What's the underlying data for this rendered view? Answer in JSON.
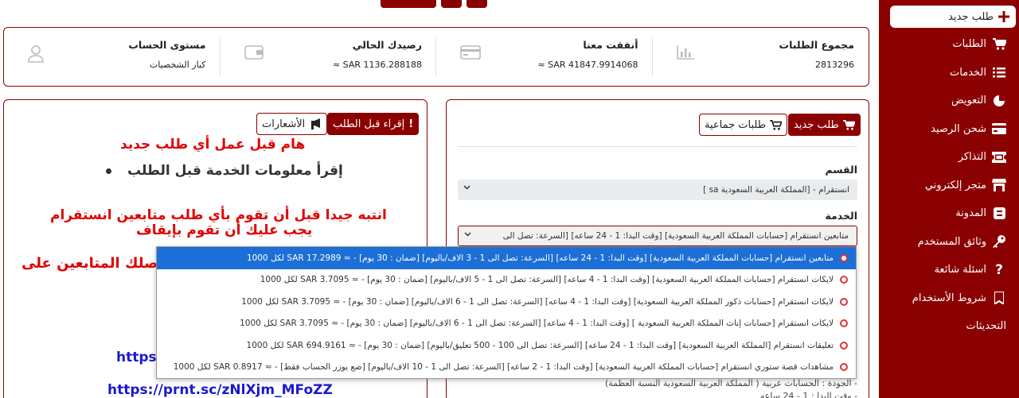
{
  "sidebar": {
    "new_order": "طلب جديد",
    "items": [
      {
        "label": "الطلبات",
        "icon": "cart-icon"
      },
      {
        "label": "الخدمات",
        "icon": "list-icon"
      },
      {
        "label": "التعويض",
        "icon": "pie-icon"
      },
      {
        "label": "شحن الرصيد",
        "icon": "credit-card-icon"
      },
      {
        "label": "التذاكر",
        "icon": "ticket-icon"
      },
      {
        "label": "متجر إلكتروني",
        "icon": "store-icon"
      },
      {
        "label": "المدونة",
        "icon": "blog-icon"
      },
      {
        "label": "وثائق المستخدم",
        "icon": "key-icon"
      },
      {
        "label": "اسئلة شائعة",
        "icon": "question-icon"
      },
      {
        "label": "شروط الأستخدام",
        "icon": "bookmark-icon"
      },
      {
        "label": "التحديثات",
        "icon": ""
      }
    ]
  },
  "stats": [
    {
      "title": "مجموع الطلبات",
      "value": "2813296",
      "icon": "bar-chart-icon"
    },
    {
      "title": "أنفقت معنا",
      "value": "SAR 41847.9914068 ≈",
      "icon": "money-icon"
    },
    {
      "title": "رصيدك الحالي",
      "value": "SAR 1136.288188 ≈",
      "icon": "wallet-icon"
    },
    {
      "title": "مستوى الحساب",
      "value": "كبار الشخصيات",
      "icon": "user-icon"
    }
  ],
  "left_panel": {
    "read_button": "إقراء قبل الطلب",
    "notifications_button": "الأشعارات",
    "heading_important": "هام قبل عمل أي طلب جديد",
    "bullet_text": "إقرأ معلومات الخدمة قبل الطلب",
    "warning_line1": "انتبه جيدا قبل أن تقوم بأي طلب متابعين انستقرام",
    "warning_line2": "يجب عليك أن تقوم بإيقاف",
    "partial_line": "وصلك المتابعين على",
    "partial_link": "https:",
    "link": "https://prnt.sc/zNlXjm_MFoZZ"
  },
  "right_panel": {
    "new_order_button": "طلب جديد",
    "bulk_button": "طلبات جماعية",
    "category_label": "القسم",
    "category_value": "انستقرام - [المملكة العربية السعودية sa ]",
    "service_label": "الخدمة",
    "service_value": "متابعين انستقرام [حسابات المملكة العربية السعودية] [وقت البدا: 1 - 24 ساعه] [السرعة: تصل الى",
    "desc_line1": "- الجودة : الحسابات عربية ( المملكة العربية السعودية النسبة العظمة)",
    "desc_line2": "- وقت البدا : 1 - 24 ساعه"
  },
  "dropdown": {
    "options": [
      "متابعين انستقرام [حسابات المملكة العربية السعودية] [وقت البدا: 1 - 24 ساعه] [السرعة: تصل الى 1 - 3 الاف/باليوم] [ضمان : 30 يوم] - ≈ SAR 17.2989 لكل 1000",
      "لايكات انستقرام [حسابات المملكة العربية السعودية] [وقت البدا: 1 - 4 ساعه] [السرعة: تصل الى 1 - 5 الاف/باليوم] [ضمان : 30 يوم] - ≈ SAR 3.7095 لكل 1000",
      "لايكات انستقرام [حسابات ذكور المملكة العربية السعودية] [وقت البدا: 1 - 4 ساعه] [السرعة: تصل الى 1 - 6 الاف/باليوم] [ضمان : 30 يوم] - ≈ SAR 3.7095 لكل 1000",
      "لايكات انستقرام [حسابات إناث المملكة العربية السعودية ] [وقت البدا: 1 - 4 ساعه] [السرعة: تصل الى 1 - 6 الاف/باليوم] [ضمان : 30 يوم] - ≈ SAR 3.7095 لكل 1000",
      "تعليقات انستقرام [المملكة العربية السعودية] [وقت البدا: 1 - 24 ساعه] [السرعة: تصل الى 100 - 500 تعليق/باليوم] [ضمان : 30 يوم] - ≈ SAR 694.9161 لكل 1000",
      "مشاهدات قصة ستوري انستقرام [حسابات المملكة العربية السعودية] [وقت البدا: 1 - 2 ساعه] [السرعة: تصل الى 1 - 10 الاف/باليوم] [ضع يوزر الحساب فقط] - ≈ SAR 0.8917 لكل 1000"
    ],
    "selected_index": 0
  },
  "colors": {
    "brand": "#8b0000",
    "selected": "#1c6fd6",
    "warning": "#e00000",
    "link": "#1a1ad0"
  }
}
